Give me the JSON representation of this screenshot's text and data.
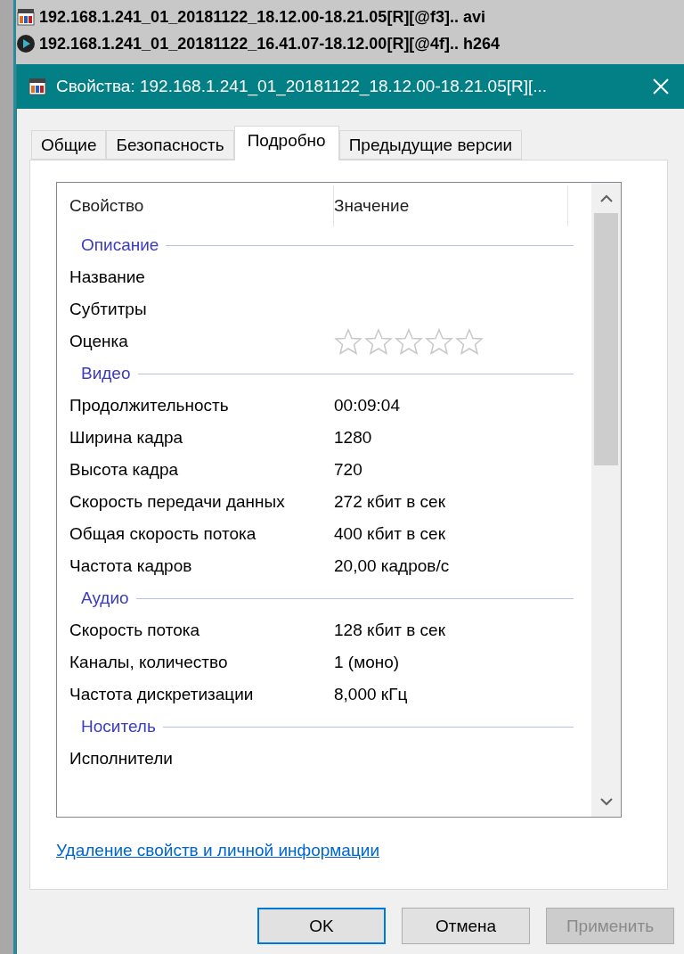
{
  "files": [
    {
      "name": "192.168.1.241_01_20181122_18.12.00-18.21.05[R][@f3].. avi",
      "kind": "clip"
    },
    {
      "name": "192.168.1.241_01_20181122_16.41.07-18.12.00[R][@4f].. h264",
      "kind": "player"
    }
  ],
  "window": {
    "title": "Свойства: 192.168.1.241_01_20181122_18.12.00-18.21.05[R][..."
  },
  "tabs": [
    {
      "label": "Общие",
      "selected": false
    },
    {
      "label": "Безопасность",
      "selected": false
    },
    {
      "label": "Подробно",
      "selected": true
    },
    {
      "label": "Предыдущие версии",
      "selected": false
    }
  ],
  "table": {
    "columns": [
      "Свойство",
      "Значение"
    ],
    "rows": [
      {
        "kind": "group",
        "label": "Описание"
      },
      {
        "kind": "prop",
        "name": "Название"
      },
      {
        "kind": "prop",
        "name": "Субтитры"
      },
      {
        "kind": "rating",
        "name": "Оценка",
        "stars": 0
      },
      {
        "kind": "group",
        "label": "Видео"
      },
      {
        "kind": "prop",
        "name": "Продолжительность",
        "value": "00:09:04"
      },
      {
        "kind": "prop",
        "name": "Ширина кадра",
        "value": "1280"
      },
      {
        "kind": "prop",
        "name": "Высота кадра",
        "value": "720"
      },
      {
        "kind": "prop",
        "name": "Скорость передачи данных",
        "value": "272 кбит в сек"
      },
      {
        "kind": "prop",
        "name": "Общая скорость потока",
        "value": "400 кбит в сек"
      },
      {
        "kind": "prop",
        "name": "Частота кадров",
        "value": "20,00 кадров/с"
      },
      {
        "kind": "group",
        "label": "Аудио"
      },
      {
        "kind": "prop",
        "name": "Скорость потока",
        "value": "128 кбит в сек"
      },
      {
        "kind": "prop",
        "name": "Каналы, количество",
        "value": "1 (моно)"
      },
      {
        "kind": "prop",
        "name": "Частота дискретизации",
        "value": "8,000 кГц"
      },
      {
        "kind": "group",
        "label": "Носитель"
      },
      {
        "kind": "prop",
        "name": "Исполнители"
      }
    ]
  },
  "link": "Удаление свойств и личной информации",
  "buttons": [
    {
      "label": "OK",
      "default": true,
      "disabled": false
    },
    {
      "label": "Отмена",
      "default": false,
      "disabled": false
    },
    {
      "label": "Применить",
      "default": false,
      "disabled": true
    }
  ]
}
